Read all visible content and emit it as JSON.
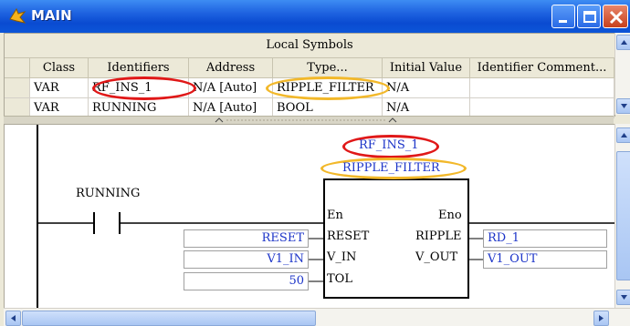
{
  "window": {
    "title": "MAIN"
  },
  "symbols": {
    "header": "Local Symbols",
    "columns": [
      "Class",
      "Identifiers",
      "Address",
      "Type...",
      "Initial Value",
      "Identifier Comment..."
    ],
    "rows": [
      [
        "VAR",
        "RF_INS_1",
        "N/A [Auto]",
        "RIPPLE_FILTER",
        "N/A",
        ""
      ],
      [
        "VAR",
        "RUNNING",
        "N/A [Auto]",
        "BOOL",
        "N/A",
        ""
      ]
    ]
  },
  "ladder": {
    "contact_label": "RUNNING",
    "instance_name": "RF_INS_1",
    "block_type": "RIPPLE_FILTER",
    "pins_in": [
      "En",
      "RESET",
      "V_IN",
      "TOL"
    ],
    "pins_out": [
      "Eno",
      "RIPPLE",
      "V_OUT"
    ],
    "inputs": [
      "RESET",
      "V1_IN",
      "50"
    ],
    "outputs": [
      "RD_1",
      "V1_OUT"
    ]
  },
  "colors": {
    "highlight_red": "#e01818",
    "highlight_yellow": "#f2b82a",
    "title_blue": "#0a4bd1",
    "value_blue": "#1c34c8"
  }
}
